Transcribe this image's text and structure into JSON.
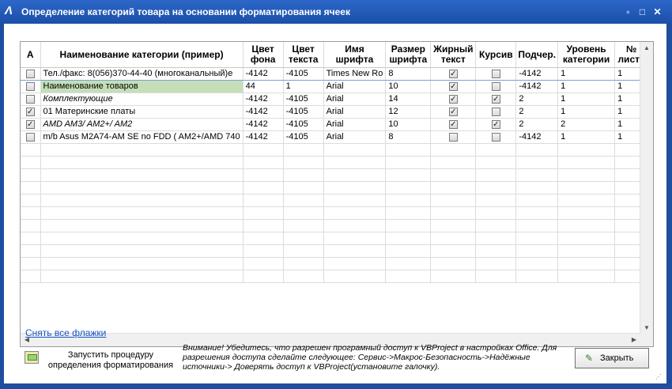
{
  "window": {
    "title": "Определение категорий товара на основании форматирования ячеек",
    "app_icon": "Λ",
    "controls": {
      "restore": "▫",
      "maximize": "□",
      "close": "✕"
    }
  },
  "grid": {
    "columns": [
      "А",
      "Наименование категории (пример)",
      "Цвет фона",
      "Цвет текста",
      "Имя шрифта",
      "Размер шрифта",
      "Жирный текст",
      "Курсив",
      "Подчер.",
      "Уровень категории",
      "№ листа"
    ],
    "rows": [
      {
        "a": false,
        "name": "Тел./факс: 8(056)370-44-40 (многоканальный)e",
        "bg": "-4142",
        "text": "-4105",
        "font": "Times New Ro",
        "size": "8",
        "bold": true,
        "italic": false,
        "underline": "-4142",
        "level": "1",
        "sheet": "1",
        "selected": true
      },
      {
        "a": false,
        "name": "Наименование товаров",
        "bg": "44",
        "text": "1",
        "font": "Arial",
        "size": "10",
        "bold": true,
        "italic": false,
        "underline": "-4142",
        "level": "1",
        "sheet": "1",
        "name_bg": "#c4dfb8"
      },
      {
        "a": false,
        "name": "Комплектующие",
        "bg": "-4142",
        "text": "-4105",
        "font": "Arial",
        "size": "14",
        "bold": true,
        "italic": true,
        "underline": "2",
        "level": "1",
        "sheet": "1",
        "italic_name": true
      },
      {
        "a": true,
        "name": "01 Материнские платы",
        "bg": "-4142",
        "text": "-4105",
        "font": "Arial",
        "size": "12",
        "bold": true,
        "italic": false,
        "underline": "2",
        "level": "1",
        "sheet": "1"
      },
      {
        "a": true,
        "name": "AMD  AM3/ AM2+/ AM2",
        "bg": "-4142",
        "text": "-4105",
        "font": "Arial",
        "size": "10",
        "bold": true,
        "italic": true,
        "underline": "2",
        "level": "2",
        "sheet": "1",
        "italic_name": true
      },
      {
        "a": false,
        "name": "m/b Asus M2A74-AM SE no FDD ( AM2+/AMD 740",
        "bg": "-4142",
        "text": "-4105",
        "font": "Arial",
        "size": "8",
        "bold": false,
        "italic": false,
        "underline": "-4142",
        "level": "1",
        "sheet": "1"
      }
    ]
  },
  "uncheck_all_link": "Снять все флажки",
  "run_button": {
    "label": "Запустить процедуру определения форматирования",
    "icon": "run-macro-icon"
  },
  "warning": "Внимание! Убедитесь, что разрешен програмный доступ к VBProject в настройках Office. Для разрешения доступа сделайте следующее: Сервис->Макрос-Безопасность->Надёжные источники-> Доверять доступ к VBProject(установите галочку).",
  "close_button": {
    "label": "Закрыть",
    "icon": "close-action-icon"
  },
  "colors": {
    "title_bar": "#1f4ea0",
    "link": "#1a55c8",
    "highlight_cell": "#c4dfb8"
  }
}
